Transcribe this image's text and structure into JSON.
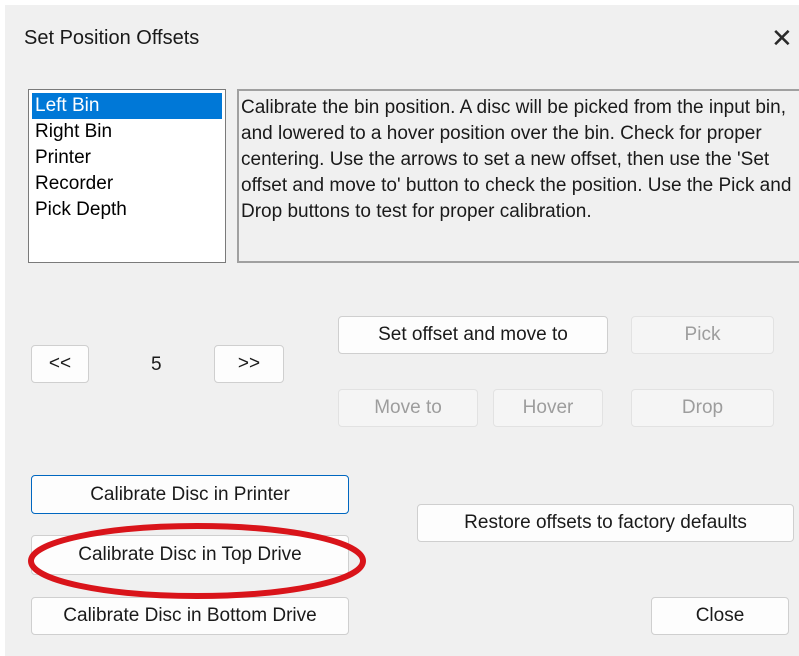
{
  "window": {
    "title": "Set Position Offsets",
    "close_glyph": "✕"
  },
  "positions": {
    "items": [
      {
        "label": "Left Bin",
        "selected": true
      },
      {
        "label": "Right Bin",
        "selected": false
      },
      {
        "label": "Printer",
        "selected": false
      },
      {
        "label": "Recorder",
        "selected": false
      },
      {
        "label": "Pick Depth",
        "selected": false
      }
    ]
  },
  "description": {
    "text": "Calibrate the bin position. A disc will be picked from the input bin, and lowered to a hover position over the bin. Check for proper centering. Use the arrows to set a new offset, then use the 'Set offset and move to' button to check the position. Use the Pick and Drop buttons to test for proper calibration."
  },
  "offset": {
    "decrease_label": "<<",
    "value": "5",
    "increase_label": ">>"
  },
  "actions": {
    "set_offset_label": "Set offset and move to",
    "pick_label": "Pick",
    "move_to_label": "Move to",
    "hover_label": "Hover",
    "drop_label": "Drop"
  },
  "calibration": {
    "printer_label": "Calibrate Disc in Printer",
    "top_drive_label": "Calibrate Disc in Top Drive",
    "bottom_drive_label": "Calibrate Disc in Bottom Drive"
  },
  "footer": {
    "restore_label": "Restore offsets to factory defaults",
    "close_label": "Close"
  },
  "colors": {
    "selection": "#0078d7",
    "annotation_ellipse": "#d9141a",
    "dialog_bg": "#f0f0f0",
    "focus_border": "#0067c0"
  }
}
